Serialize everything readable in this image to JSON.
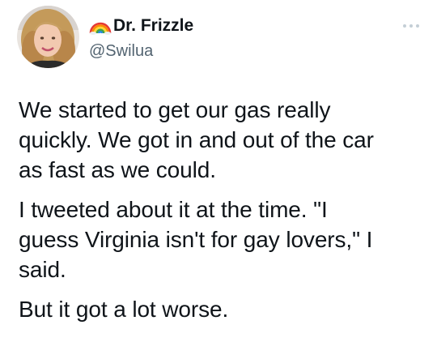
{
  "author": {
    "display_name": "Dr. Frizzle",
    "handle": "@Swilua",
    "name_emoji": "rainbow-icon",
    "avatar": "profile-avatar"
  },
  "menu": {
    "icon": "more-options-icon"
  },
  "tweet": {
    "paragraphs": [
      "We started to get our gas really\nquickly. We got in and out of the car\nas fast as we could.",
      "I tweeted about it at the time. \"I\nguess Virginia isn't for gay lovers,\" I\nsaid.",
      "But it got a lot worse."
    ]
  },
  "colors": {
    "text": "#0f1419",
    "secondary_text": "#536471",
    "background": "#ffffff"
  }
}
